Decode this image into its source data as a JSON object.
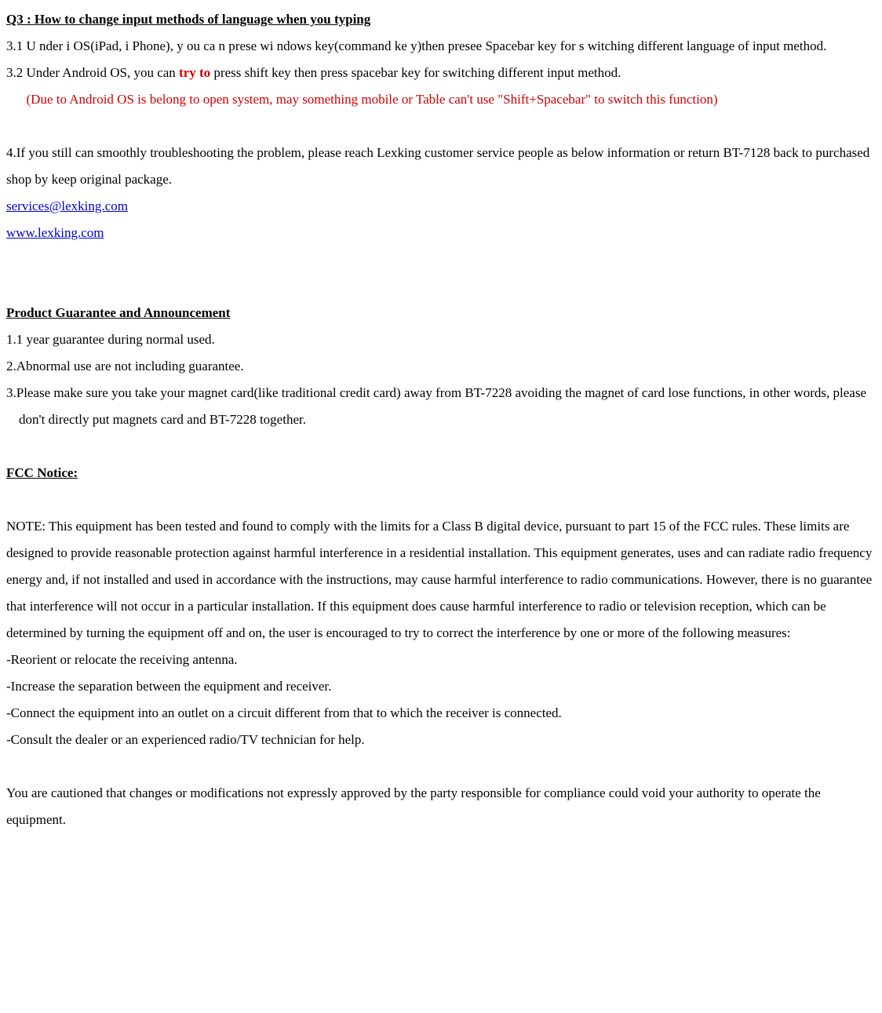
{
  "q3": {
    "heading": "Q3 : How to change input methods of language when you typing",
    "p1": "3.1 U nder i OS(iPad, i Phone), y ou ca n  prese wi ndows  key(command ke y)then  presee  Spacebar  key  for s witching  different language of input method.",
    "p2a": "3.2 Under Android OS, you can ",
    "p2b": "try to",
    "p2c": " press shift key then press spacebar key for switching different input method.",
    "p3": "(Due to Android  OS is  belong to  open system,  may something mobile or Table can't  use \"Shift+Spacebar\" to switch this function)"
  },
  "s4": {
    "p1": "4.If you still can smoothly troubleshooting the problem, please reach Lexking customer service people as below information or return BT-7128 back to purchased shop by keep original package.",
    "email": "services@lexking.com",
    "url": "www.lexking.com"
  },
  "guarantee": {
    "heading": "Product Guarantee and Announcement",
    "i1": "1.1 year guarantee during normal used.",
    "i2": "2.Abnormal use are not including guarantee.",
    "i3": "3.Please make sure you take your magnet card(like traditional credit card) away from BT-7228 avoiding the magnet of card lose functions, in other words, please don't directly put magnets card and BT-7228 together."
  },
  "fcc": {
    "heading": "FCC Notice:",
    "note": "NOTE: This equipment has been tested and found to comply with the limits for a Class B digital device, pursuant to part 15 of the FCC rules. These limits are designed to provide reasonable protection against harmful interference in a residential installation. This equipment generates, uses and can radiate radio frequency energy and, if not installed and used in accordance with the instructions, may cause harmful interference to radio communications. However, there is no guarantee that interference will not occur in a particular installation. If this equipment does cause harmful interference to radio or television reception, which can be determined by turning the equipment off and on, the user is encouraged to try to correct the interference by one or more of the following measures:",
    "m1": "-Reorient or relocate the receiving antenna.",
    "m2": "-Increase the separation between the equipment and receiver.",
    "m3": "-Connect the equipment into an outlet on a circuit different from that to which the receiver is connected.",
    "m4": "-Consult the dealer or an experienced radio/TV technician for help.",
    "caution": "You are cautioned that changes or modifications not expressly approved by the party responsible for compliance could void your authority to operate the equipment."
  }
}
